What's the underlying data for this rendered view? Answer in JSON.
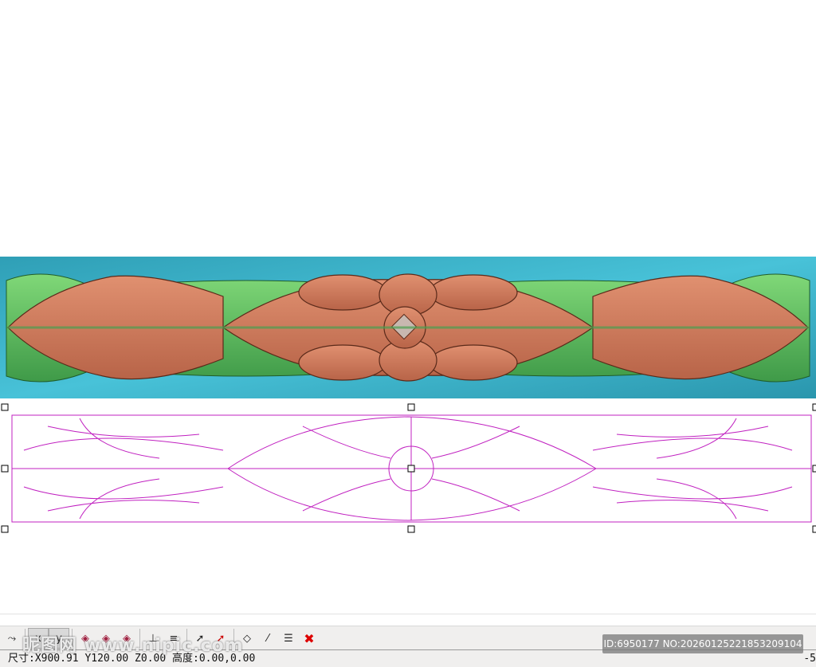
{
  "status_bar": {
    "text": "尺寸:X900.91 Y120.00 Z0.00 高度:0.00,0.00",
    "right_text": "-5"
  },
  "toolbar": {
    "icons": [
      "curve-tool-icon",
      "view-x-icon",
      "view-y-icon",
      "surface-red-icon",
      "surface-red2-icon",
      "surface-red3-icon",
      "layer-flat-icon",
      "layer-stack-icon",
      "select-cross-icon",
      "select-delete-icon",
      "project-icon",
      "node-edit-icon",
      "list-icon",
      "delete-icon"
    ]
  },
  "watermark": {
    "site": "昵图网 www.nipic.com",
    "id": "ID:6950177 NO:20260125221853209104"
  },
  "colors": {
    "teal": "#3aaec4",
    "copper": "#d07c5a",
    "green": "#5cbd5e",
    "vector": "#c020c0"
  }
}
